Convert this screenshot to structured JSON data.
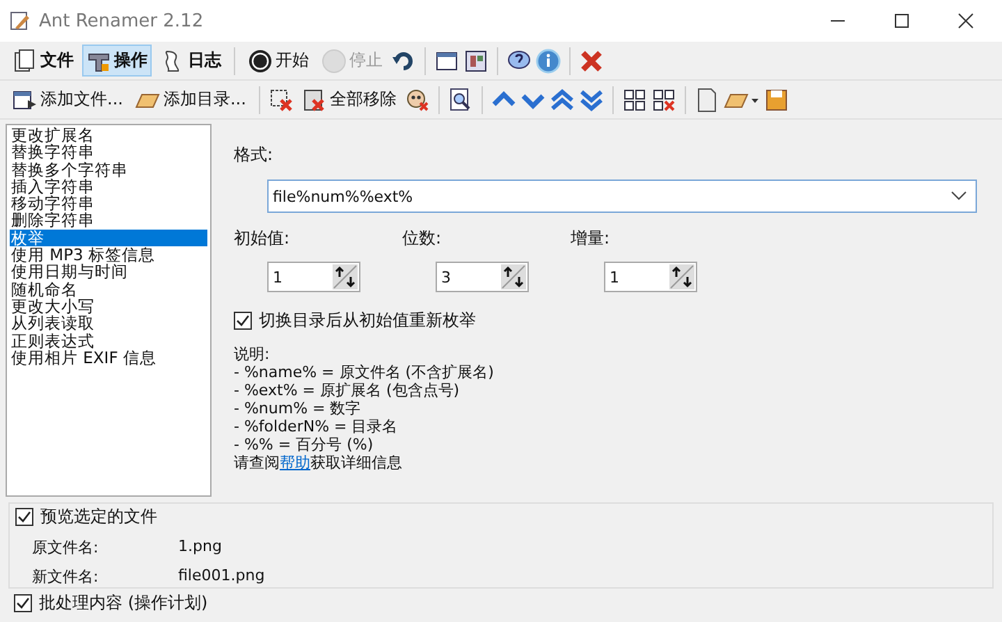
{
  "window": {
    "title": "Ant Renamer 2.12"
  },
  "main_toolbar": [
    {
      "label": "文件",
      "selected": false,
      "disabled": false
    },
    {
      "label": "操作",
      "selected": true,
      "disabled": false
    },
    {
      "label": "日志",
      "selected": false,
      "disabled": false
    },
    {
      "label": "开始",
      "selected": false,
      "disabled": false
    },
    {
      "label": "停止",
      "selected": false,
      "disabled": true
    }
  ],
  "file_toolbar": {
    "add_files": "添加文件...",
    "add_folder": "添加目录...",
    "remove_all": "全部移除"
  },
  "actions": [
    {
      "label": "更改扩展名",
      "selected": false
    },
    {
      "label": "替换字符串",
      "selected": false
    },
    {
      "label": "替换多个字符串",
      "selected": false
    },
    {
      "label": "插入字符串",
      "selected": false
    },
    {
      "label": "移动字符串",
      "selected": false
    },
    {
      "label": "删除字符串",
      "selected": false
    },
    {
      "label": "枚举",
      "selected": true
    },
    {
      "label": "使用 MP3 标签信息",
      "selected": false
    },
    {
      "label": "使用日期与时间",
      "selected": false
    },
    {
      "label": "随机命名",
      "selected": false
    },
    {
      "label": "更改大小写",
      "selected": false
    },
    {
      "label": "从列表读取",
      "selected": false
    },
    {
      "label": "正则表达式",
      "selected": false
    },
    {
      "label": "使用相片 EXIF 信息",
      "selected": false
    }
  ],
  "options": {
    "format_label": "格式:",
    "format_value": "file%num%%ext%",
    "spinners": [
      {
        "label": "初始值:",
        "value": "1"
      },
      {
        "label": "位数:",
        "value": "3"
      },
      {
        "label": "增量:",
        "value": "1"
      }
    ],
    "restart": {
      "label": "切换目录后从初始值重新枚举",
      "checked": true
    },
    "help_lines": [
      "说明:",
      "- %name% = 原文件名 (不含扩展名)",
      "- %ext% = 原扩展名 (包含点号)",
      "- %num% = 数字",
      "- %folderN% = 目录名",
      "- %% = 百分号 (%)"
    ],
    "help_link": {
      "before": "请查阅",
      "link": "帮助",
      "after": "获取详细信息"
    }
  },
  "preview": {
    "label": "预览选定的文件",
    "checked": true,
    "rows": [
      {
        "name": "原文件名:",
        "value": "1.png"
      },
      {
        "name": "新文件名:",
        "value": "file001.png"
      }
    ]
  },
  "batch": {
    "label": "批处理内容 (操作计划)",
    "checked": true
  }
}
